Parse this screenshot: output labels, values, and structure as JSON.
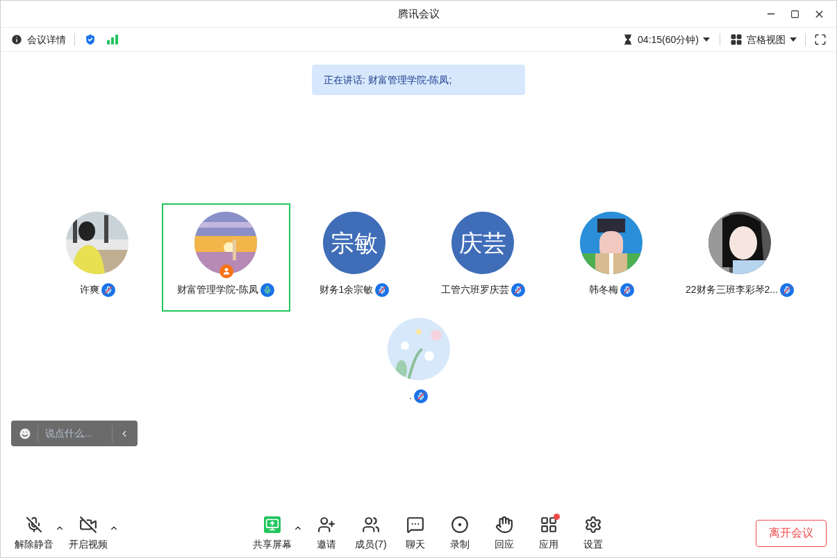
{
  "window": {
    "title": "腾讯会议"
  },
  "top_bar": {
    "details": "会议详情",
    "timer": "04:15(60分钟)",
    "view": "宫格视图"
  },
  "speaking_banner": "正在讲话: 财富管理学院-陈凤;",
  "participants": [
    {
      "name": "许爽",
      "muted": true,
      "selected": false,
      "host": false
    },
    {
      "name": "财富管理学院-陈凤",
      "muted": false,
      "selected": true,
      "host": true
    },
    {
      "name": "财务1余宗敏",
      "avatar": {
        "kind": "initials",
        "text": "宗敏"
      },
      "muted": true,
      "selected": false,
      "host": false
    },
    {
      "name": "工管六班罗庆芸",
      "avatar": {
        "kind": "initials",
        "text": "庆芸"
      },
      "muted": true,
      "selected": false,
      "host": false
    },
    {
      "name": "韩冬梅",
      "muted": true,
      "selected": false,
      "host": false
    },
    {
      "name": "22财务三班李彩琴2...",
      "muted": true,
      "selected": false,
      "host": false
    },
    {
      "name": ".",
      "muted": true,
      "selected": false,
      "host": false
    }
  ],
  "chat_box": {
    "placeholder": "说点什么..."
  },
  "toolbar": [
    {
      "kind": "mic",
      "label": "解除静音",
      "has_menu": true,
      "notification": false
    },
    {
      "kind": "video",
      "label": "开启视频",
      "has_menu": true,
      "notification": false
    },
    {
      "kind": "share",
      "label": "共享屏幕",
      "has_menu": true,
      "notification": false
    },
    {
      "kind": "invite",
      "label": "邀请",
      "has_menu": false,
      "notification": false
    },
    {
      "kind": "members",
      "label": "成员(7)",
      "has_menu": false,
      "notification": false
    },
    {
      "kind": "chat",
      "label": "聊天",
      "has_menu": false,
      "notification": false
    },
    {
      "kind": "record",
      "label": "录制",
      "has_menu": false,
      "notification": false
    },
    {
      "kind": "react",
      "label": "回应",
      "has_menu": false,
      "notification": false
    },
    {
      "kind": "apps",
      "label": "应用",
      "has_menu": false,
      "notification": true
    },
    {
      "kind": "settings",
      "label": "设置",
      "has_menu": false,
      "notification": false
    }
  ],
  "leave_button": "离开会议"
}
